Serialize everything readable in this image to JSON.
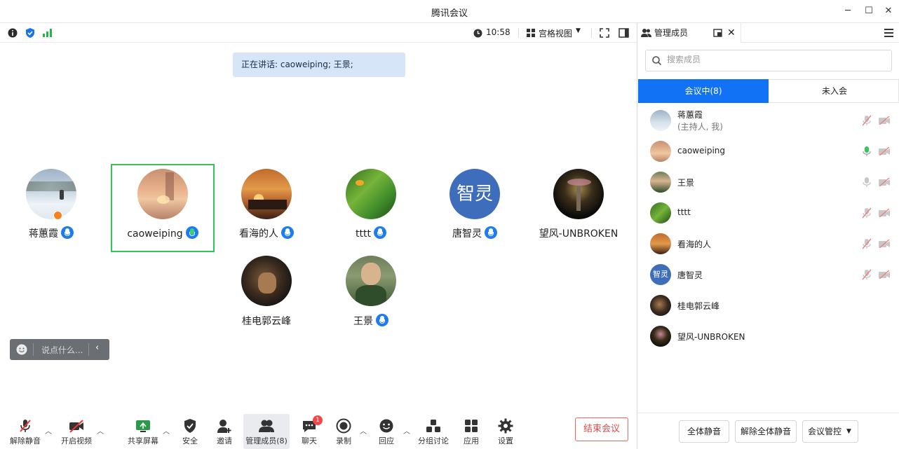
{
  "window": {
    "title": "腾讯会议"
  },
  "infobar": {
    "time": "10:58",
    "view_label": "宫格视图"
  },
  "speaking": {
    "text": "正在讲话: caoweiping; 王景;"
  },
  "tiles": [
    {
      "name": "蒋蕙霞"
    },
    {
      "name": "caoweiping"
    },
    {
      "name": "看海的人"
    },
    {
      "name": "tttt"
    },
    {
      "name": "唐智灵",
      "avatar_text": "智灵"
    },
    {
      "name": "望风-UNBROKEN"
    },
    {
      "name": "桂电郭云峰"
    },
    {
      "name": "王景"
    }
  ],
  "chat": {
    "placeholder": "说点什么..."
  },
  "toolbar": {
    "unmute": "解除静音",
    "video": "开启视频",
    "share": "共享屏幕",
    "security": "安全",
    "invite": "邀请",
    "members": "管理成员(8)",
    "chat": "聊天",
    "chat_badge": "1",
    "record": "录制",
    "echo": "回应",
    "breakout": "分组讨论",
    "apps": "应用",
    "settings": "设置",
    "end": "结束会议"
  },
  "panel": {
    "title": "管理成员",
    "search_placeholder": "搜索成员",
    "tab_in": "会议中(8)",
    "tab_out": "未入会",
    "members": [
      {
        "name": "蒋蕙霞",
        "sub": "(主持人, 我)"
      },
      {
        "name": "caoweiping"
      },
      {
        "name": "王景"
      },
      {
        "name": "tttt"
      },
      {
        "name": "看海的人"
      },
      {
        "name": "唐智灵",
        "avatar_text": "智灵"
      },
      {
        "name": "桂电郭云峰"
      },
      {
        "name": "望风-UNBROKEN"
      }
    ],
    "mute_all": "全体静音",
    "unmute_all": "解除全体静音",
    "control": "会议管控"
  }
}
